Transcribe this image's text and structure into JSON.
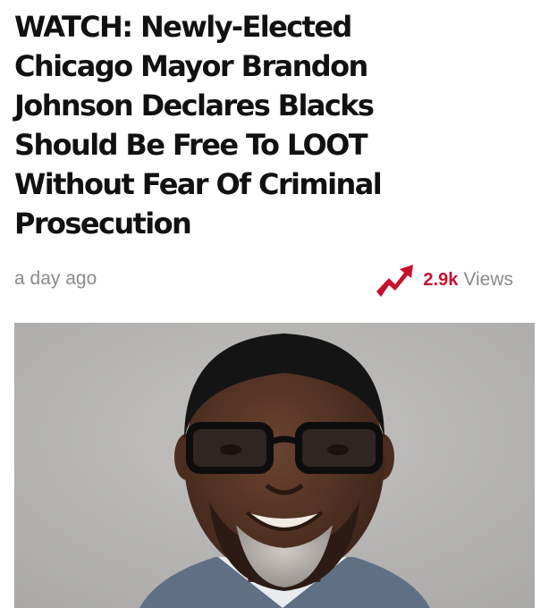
{
  "article": {
    "headline_lines": [
      "WATCH: Newly-Elected",
      "Chicago Mayor Brandon",
      "Johnson Declares Blacks",
      "Should Be Free To LOOT",
      "Without Fear Of Criminal",
      "Prosecution"
    ],
    "timestamp": "a day ago",
    "views_count": "2.9k",
    "views_label": "Views",
    "trend_icon": "trending-up-arrow-icon",
    "photo_subject": "portrait-photo"
  },
  "colors": {
    "accent": "#c8102e",
    "muted_text": "#8a8a8a",
    "headline_text": "#111111",
    "photo_background": "#b9b8b6"
  }
}
